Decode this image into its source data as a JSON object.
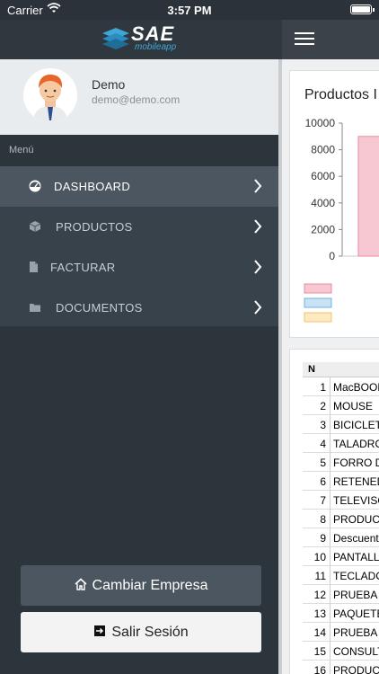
{
  "status_bar": {
    "carrier": "Carrier",
    "time": "3:57 PM"
  },
  "logo": {
    "text": "SAE",
    "subtext": "mobileapp"
  },
  "profile": {
    "name": "Demo",
    "email": "demo@demo.com"
  },
  "menu": {
    "caption": "Menú",
    "items": [
      {
        "label": "DASHBOARD",
        "icon": "dashboard-icon",
        "active": true
      },
      {
        "label": "PRODUCTOS",
        "icon": "cube-icon",
        "active": false
      },
      {
        "label": "FACTURAR",
        "icon": "document-icon",
        "active": false
      },
      {
        "label": "DOCUMENTOS",
        "icon": "folder-icon",
        "active": false
      }
    ]
  },
  "buttons": {
    "change_company": "Cambiar Empresa",
    "logout": "Salir Sesión"
  },
  "main": {
    "chart_card_title": "Productos I",
    "table_header": "N",
    "rows": [
      {
        "n": "1",
        "name": "MacBOOK"
      },
      {
        "n": "2",
        "name": "MOUSE"
      },
      {
        "n": "3",
        "name": "BICICLETA"
      },
      {
        "n": "4",
        "name": "TALADRO"
      },
      {
        "n": "5",
        "name": "FORRO DI"
      },
      {
        "n": "6",
        "name": "RETENED"
      },
      {
        "n": "7",
        "name": "TELEVISO"
      },
      {
        "n": "8",
        "name": "PRODUCT"
      },
      {
        "n": "9",
        "name": "Descuent"
      },
      {
        "n": "10",
        "name": "PANTALLA"
      },
      {
        "n": "11",
        "name": "TECLADO"
      },
      {
        "n": "12",
        "name": "PRUEBA P"
      },
      {
        "n": "13",
        "name": "PAQUETE"
      },
      {
        "n": "14",
        "name": "PRUEBA L"
      },
      {
        "n": "15",
        "name": "CONSULT"
      },
      {
        "n": "16",
        "name": "PRODUCT"
      }
    ]
  },
  "chart_data": {
    "type": "bar",
    "title": "Productos I",
    "yticks": [
      "10000",
      "8000",
      "6000",
      "4000",
      "2000",
      "0"
    ],
    "ylim": [
      0,
      10000
    ],
    "series": [
      {
        "values": [
          9000
        ],
        "color": "#f8c8d2"
      }
    ],
    "legend_colors": [
      "#f8c8d2",
      "#c9e3f5",
      "#fde9c2"
    ]
  }
}
